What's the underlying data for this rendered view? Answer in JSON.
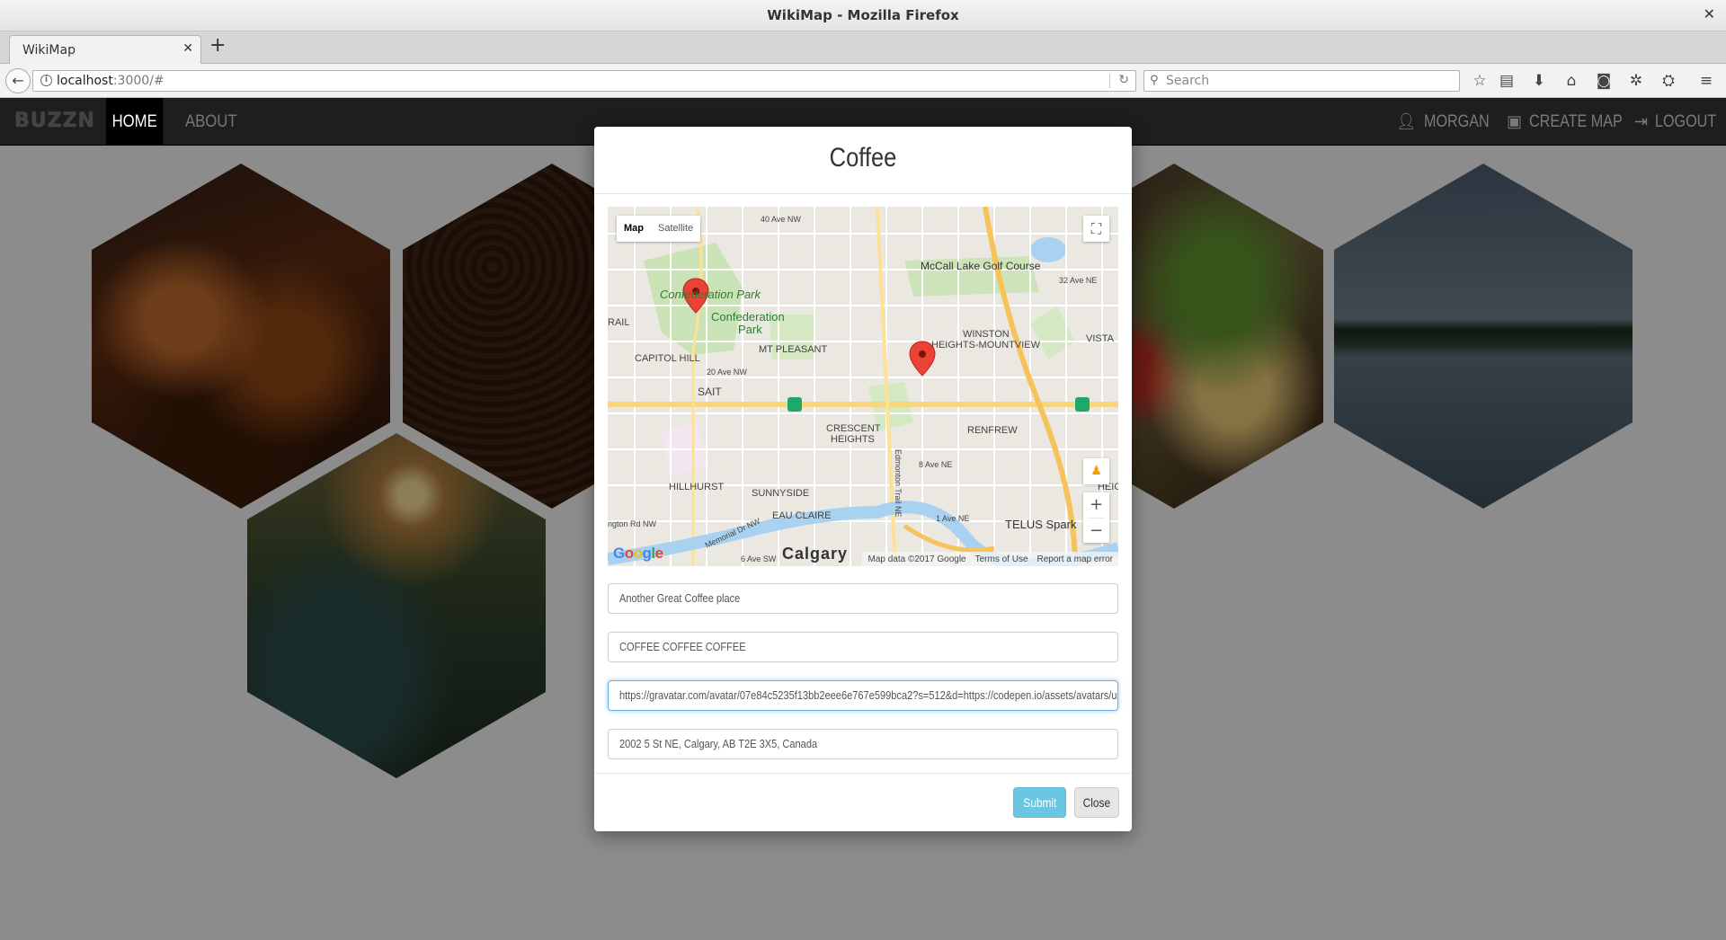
{
  "window": {
    "title": "WikiMap - Mozilla Firefox"
  },
  "browser": {
    "tab_title": "WikiMap",
    "url_host": "localhost",
    "url_rest": ":3000/#",
    "search_placeholder": "Search"
  },
  "app": {
    "brand": "BUZZN",
    "nav": {
      "home": "HOME",
      "about": "ABOUT"
    },
    "user": "MORGAN",
    "create_map": "CREATE MAP",
    "logout": "LOGOUT"
  },
  "modal": {
    "title": "Coffee",
    "map": {
      "type_map": "Map",
      "type_satellite": "Satellite",
      "google_logo": "Google",
      "attribution": "Map data ©2017 Google",
      "terms": "Terms of Use",
      "report": "Report a map error",
      "labels": [
        "Confederation Park",
        "Confederation Park",
        "CAPITOL HILL",
        "MT PLEASANT",
        "SAIT",
        "CRESCENT HEIGHTS",
        "HILLHURST",
        "SUNNYSIDE",
        "EAU CLAIRE",
        "Calgary",
        "McCall Lake Golf Course",
        "WINSTON HEIGHTS-MOUNTVIEW",
        "VISTA",
        "RENFREW",
        "TELUS Spark",
        "32 Ave NE",
        "20 Ave NW",
        "8 Ave NE",
        "1 Ave NE",
        "40 Ave NW",
        "Edmonton Trail NE",
        "Memorial Dr NW",
        "6 Ave SW",
        "RAIL",
        "HEIG",
        "ngton Rd NW"
      ]
    },
    "fields": {
      "name": "Another Great Coffee place",
      "description": "COFFEE COFFEE COFFEE",
      "image_url": "https://gravatar.com/avatar/07e84c5235f13bb2eee6e767e599bca2?s=512&d=https://codepen.io/assets/avatars/user-av",
      "address": "2002 5 St NE, Calgary, AB T2E 3X5, Canada"
    },
    "submit": "Submit",
    "close": "Close"
  }
}
